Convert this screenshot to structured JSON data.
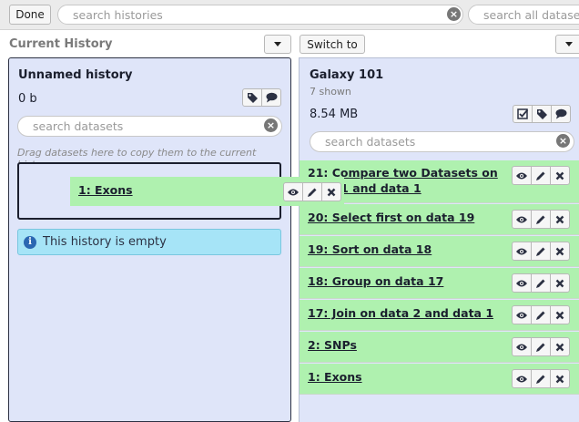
{
  "topbar": {
    "done_label": "Done",
    "search_histories_placeholder": "search histories",
    "search_all_placeholder": "search all datasets"
  },
  "current": {
    "column_title": "Current History",
    "history_name": "Unnamed history",
    "size": "0 b",
    "search_placeholder": "search datasets",
    "drag_hint": "Drag datasets here to copy them to the current history",
    "empty_message": "This history is empty"
  },
  "dragged": {
    "title": "1: Exons"
  },
  "other": {
    "switch_label": "Switch to",
    "history_name": "Galaxy 101",
    "shown": "7 shown",
    "size": "8.54 MB",
    "search_placeholder": "search datasets",
    "datasets": [
      {
        "title": "21: Compare two Datasets on data 1 and data 1"
      },
      {
        "title": "20: Select first on data 19"
      },
      {
        "title": "19: Sort on data 18"
      },
      {
        "title": "18: Group on data 17"
      },
      {
        "title": "17: Join on data 2 and data 1"
      },
      {
        "title": "2: SNPs"
      },
      {
        "title": "1: Exons"
      }
    ]
  },
  "icons": [
    "eye-icon",
    "pencil-icon",
    "delete-icon",
    "tags-icon",
    "comment-icon",
    "checkbox-icon",
    "info-icon",
    "clear-icon",
    "caret-down-icon"
  ],
  "colors": {
    "dataset_ok": "#aff1af",
    "panel_bg": "#dfe5f9",
    "info_bg": "#a6e4f7"
  }
}
